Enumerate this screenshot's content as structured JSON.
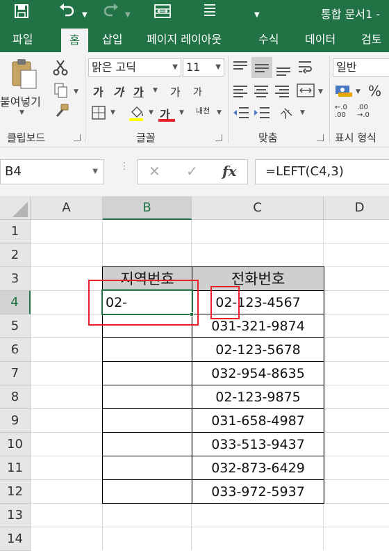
{
  "title_bar": {
    "title": "통합 문서1 -"
  },
  "tabs": [
    {
      "label": "파일",
      "active": false
    },
    {
      "label": "홈",
      "active": true
    },
    {
      "label": "삽입",
      "active": false
    },
    {
      "label": "페이지 레이아웃",
      "active": false
    },
    {
      "label": "수식",
      "active": false
    },
    {
      "label": "데이터",
      "active": false
    },
    {
      "label": "검토",
      "active": false
    }
  ],
  "ribbon": {
    "clipboard": {
      "paste_label": "붙여넣기",
      "group_label": "클립보드"
    },
    "font": {
      "font_name": "맑은 고딕",
      "font_size": "11",
      "bold": "가",
      "italic": "가",
      "underline": "가",
      "grow": "가",
      "shrink": "가",
      "font_color_glyph": "가",
      "phonetic": "내천",
      "group_label": "글꼴"
    },
    "alignment": {
      "group_label": "맞춤",
      "orientation_glyph": "가"
    },
    "number": {
      "format": "일반",
      "percent": "%",
      "dec_increase": "←.0\n.00",
      "dec_decrease": ".00\n→.0",
      "group_label": "표시 형식"
    }
  },
  "formula_bar": {
    "name_box": "B4",
    "cancel": "✕",
    "enter": "✓",
    "fx": "fx",
    "formula": "=LEFT(C4,3)"
  },
  "grid": {
    "columns": [
      "A",
      "B",
      "C",
      "D"
    ],
    "selected_column": "B",
    "rows": [
      "1",
      "2",
      "3",
      "4",
      "5",
      "6",
      "7",
      "8",
      "9",
      "10",
      "11",
      "12",
      "13",
      "14"
    ],
    "selected_row": "4",
    "headers": {
      "region_code": "지역번호",
      "phone_number": "전화번호"
    },
    "b4_value": "02-",
    "phone_numbers": [
      "02-123-4567",
      "031-321-9874",
      "02-123-5678",
      "032-954-8635",
      "02-123-9875",
      "031-658-4987",
      "033-513-9437",
      "032-873-6429",
      "033-972-5937"
    ]
  },
  "colors": {
    "excel_green": "#217346",
    "highlight_red": "#e8202a",
    "header_fill": "#d0cece"
  }
}
